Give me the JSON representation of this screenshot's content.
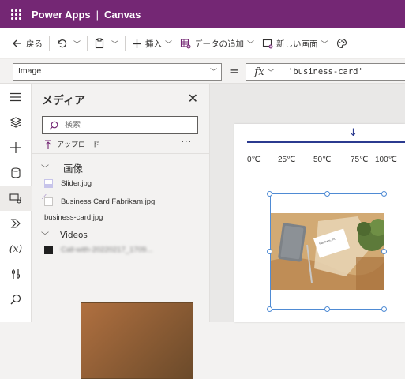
{
  "titlebar": {
    "app": "Power Apps",
    "separator": "|",
    "doc": "Canvas"
  },
  "toolbar": {
    "back": "戻る",
    "insert": "挿入",
    "add_data": "データの追加",
    "new_screen": "新しい画面"
  },
  "formula_bar": {
    "property": "Image",
    "equals": "=",
    "fx": "fx",
    "formula": "'business-card'"
  },
  "media_panel": {
    "title": "メディア",
    "search_placeholder": "検索",
    "upload": "アップロード",
    "more": "···",
    "images_group": "画像",
    "images": [
      "Slider.jpg",
      "Business Card Fabrikam.jpg",
      "business-card.jpg"
    ],
    "videos_group": "Videos",
    "videos": [
      "Call-with-20220217_1709..."
    ]
  },
  "canvas": {
    "slider_ticks": [
      "0℃",
      "25℃",
      "50℃",
      "75℃",
      "100℃"
    ]
  },
  "business_card": {
    "name": "Fabrikam, Inc."
  }
}
